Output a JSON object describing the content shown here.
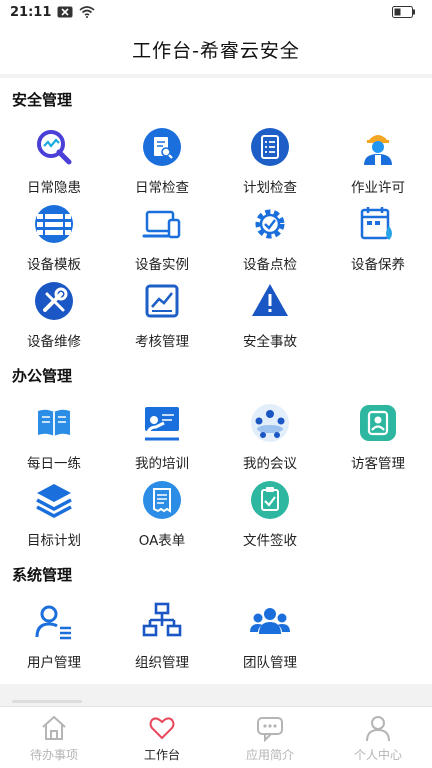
{
  "status_bar": {
    "time": "21:11"
  },
  "header": {
    "title": "工作台-希睿云安全"
  },
  "sections": [
    {
      "title": "安全管理",
      "items": [
        {
          "label": "日常隐患",
          "icon": "hazard-search-icon"
        },
        {
          "label": "日常检查",
          "icon": "inspection-doc-icon"
        },
        {
          "label": "计划检查",
          "icon": "plan-checklist-icon"
        },
        {
          "label": "作业许可",
          "icon": "worker-helmet-icon"
        },
        {
          "label": "设备模板",
          "icon": "device-template-icon"
        },
        {
          "label": "设备实例",
          "icon": "device-instance-icon"
        },
        {
          "label": "设备点检",
          "icon": "gear-check-icon"
        },
        {
          "label": "设备保养",
          "icon": "maintenance-calendar-icon"
        },
        {
          "label": "设备维修",
          "icon": "wrench-icon"
        },
        {
          "label": "考核管理",
          "icon": "chart-board-icon"
        },
        {
          "label": "安全事故",
          "icon": "warning-triangle-icon"
        }
      ]
    },
    {
      "title": "办公管理",
      "items": [
        {
          "label": "每日一练",
          "icon": "book-icon"
        },
        {
          "label": "我的培训",
          "icon": "training-board-icon"
        },
        {
          "label": "我的会议",
          "icon": "meeting-icon"
        },
        {
          "label": "访客管理",
          "icon": "visitor-card-icon"
        },
        {
          "label": "目标计划",
          "icon": "layers-icon"
        },
        {
          "label": "OA表单",
          "icon": "form-receipt-icon"
        },
        {
          "label": "文件签收",
          "icon": "clipboard-check-icon"
        }
      ]
    },
    {
      "title": "系统管理",
      "items": [
        {
          "label": "用户管理",
          "icon": "user-list-icon"
        },
        {
          "label": "组织管理",
          "icon": "org-tree-icon"
        },
        {
          "label": "团队管理",
          "icon": "team-icon"
        }
      ]
    }
  ],
  "tabs": [
    {
      "label": "待办事项",
      "icon": "home-icon",
      "active": false
    },
    {
      "label": "工作台",
      "icon": "heart-icon",
      "active": true
    },
    {
      "label": "应用简介",
      "icon": "chat-bubble-icon",
      "active": false
    },
    {
      "label": "个人中心",
      "icon": "person-icon",
      "active": false
    }
  ],
  "colors": {
    "accent_blue": "#1a6fdc",
    "active_heart": "#e6475a",
    "teal": "#2db7a0",
    "inactive": "#b5b5b5"
  }
}
